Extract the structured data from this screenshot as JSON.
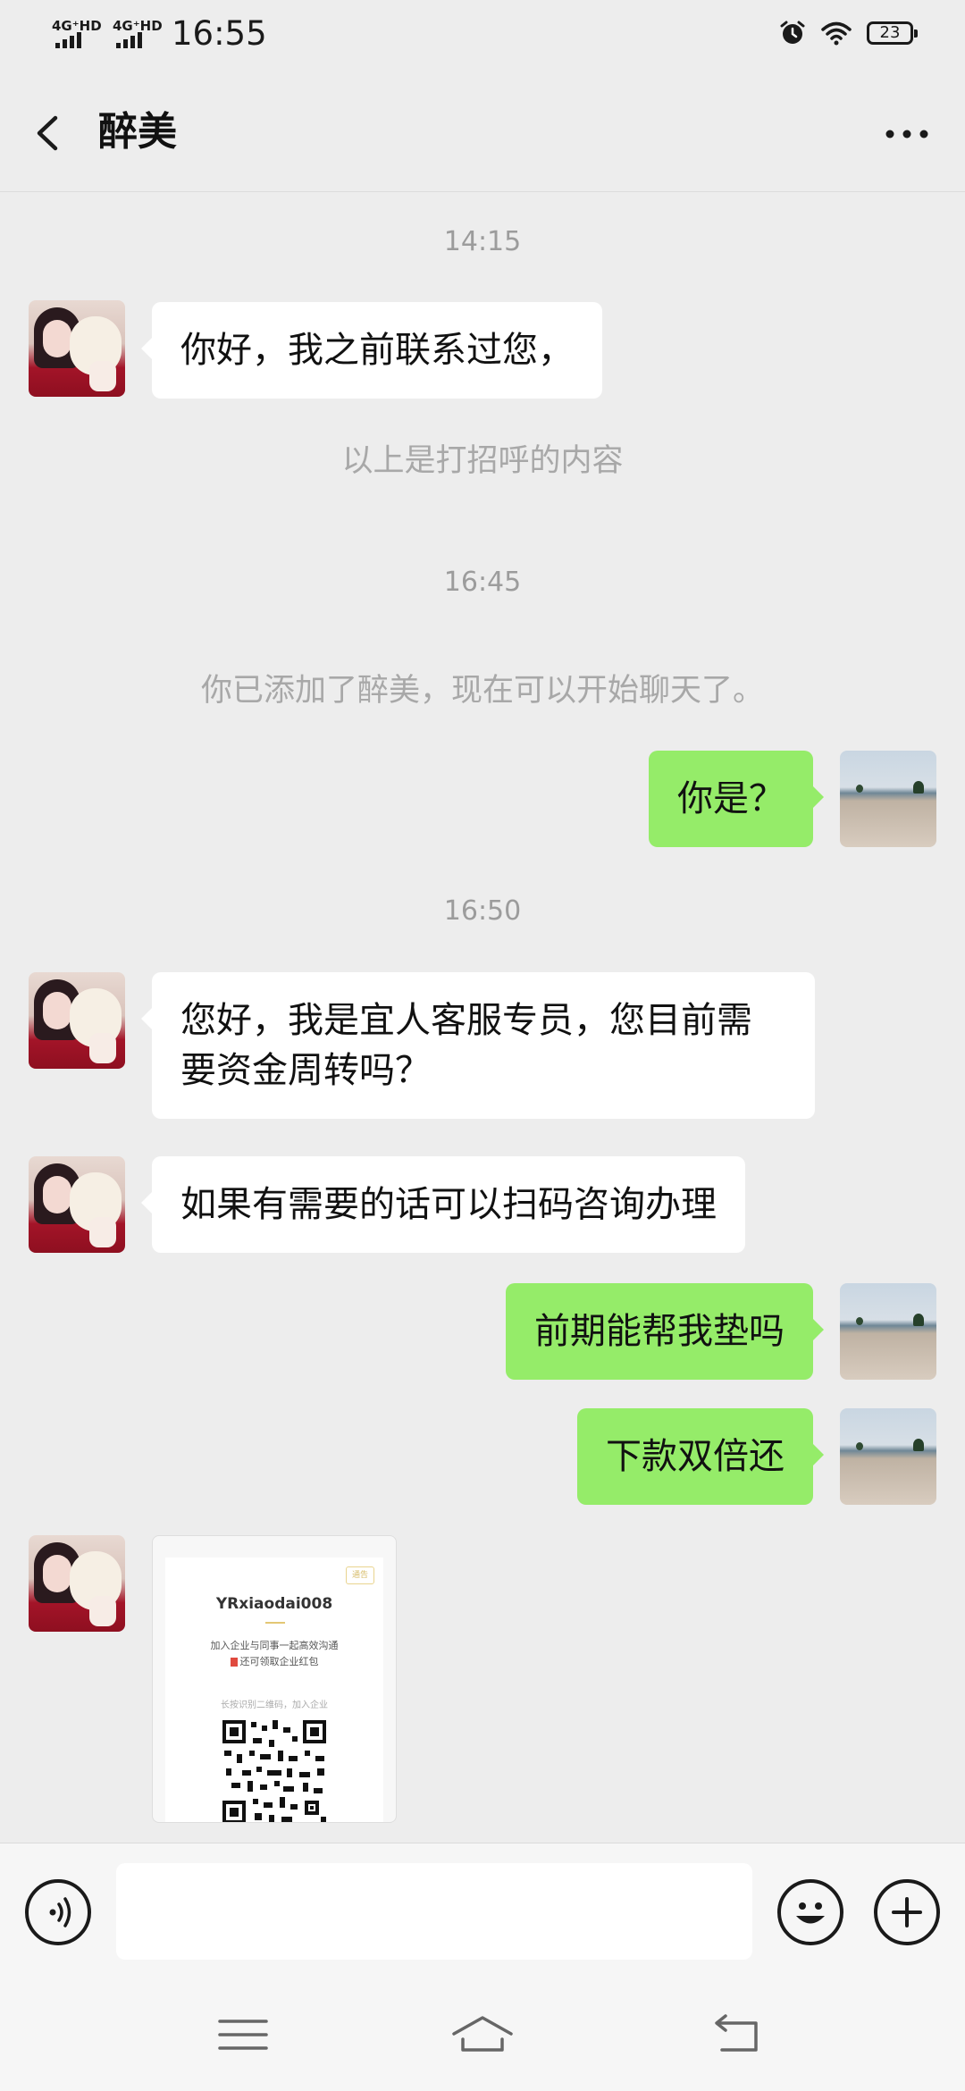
{
  "status_bar": {
    "signal_1": "4G⁺HD",
    "signal_2": "4G⁺HD",
    "time": "16:55",
    "icons": [
      "alarm-icon",
      "wifi-icon"
    ],
    "battery": "23"
  },
  "header": {
    "title": "醉美",
    "back_icon": "chevron-left-icon",
    "more_icon": "more-horizontal-icon"
  },
  "messages": {
    "time_1": "14:15",
    "in_1": "你好，我之前联系过您，",
    "system_1": "以上是打招呼的内容",
    "time_2": "16:45",
    "system_2": "你已添加了醉美，现在可以开始聊天了。",
    "out_1": "你是？",
    "time_3": "16:50",
    "in_2": "您好，我是宜人客服专员，您目前需要资金周转吗？",
    "in_3": "如果有需要的话可以扫码咨询办理",
    "out_2": "前期能帮我垫吗",
    "out_3": "下款双倍还",
    "card": {
      "stamp": "通告",
      "id": "YRxiaodai008",
      "line_1": "加入企业与同事一起高效沟通",
      "line_2": "还可领取企业红包",
      "hint": "长按识别二维码，加入企业"
    }
  },
  "input_bar": {
    "placeholder": "",
    "voice_icon": "voice-icon",
    "emoji_icon": "emoji-icon",
    "plus_icon": "plus-icon"
  },
  "nav_bar": {
    "icons": [
      "menu-icon",
      "home-icon",
      "back-icon"
    ]
  },
  "colors": {
    "background": "#ededed",
    "outgoing_bubble": "#95ec69",
    "incoming_bubble": "#ffffff",
    "meta_text": "#9c9c9c"
  }
}
